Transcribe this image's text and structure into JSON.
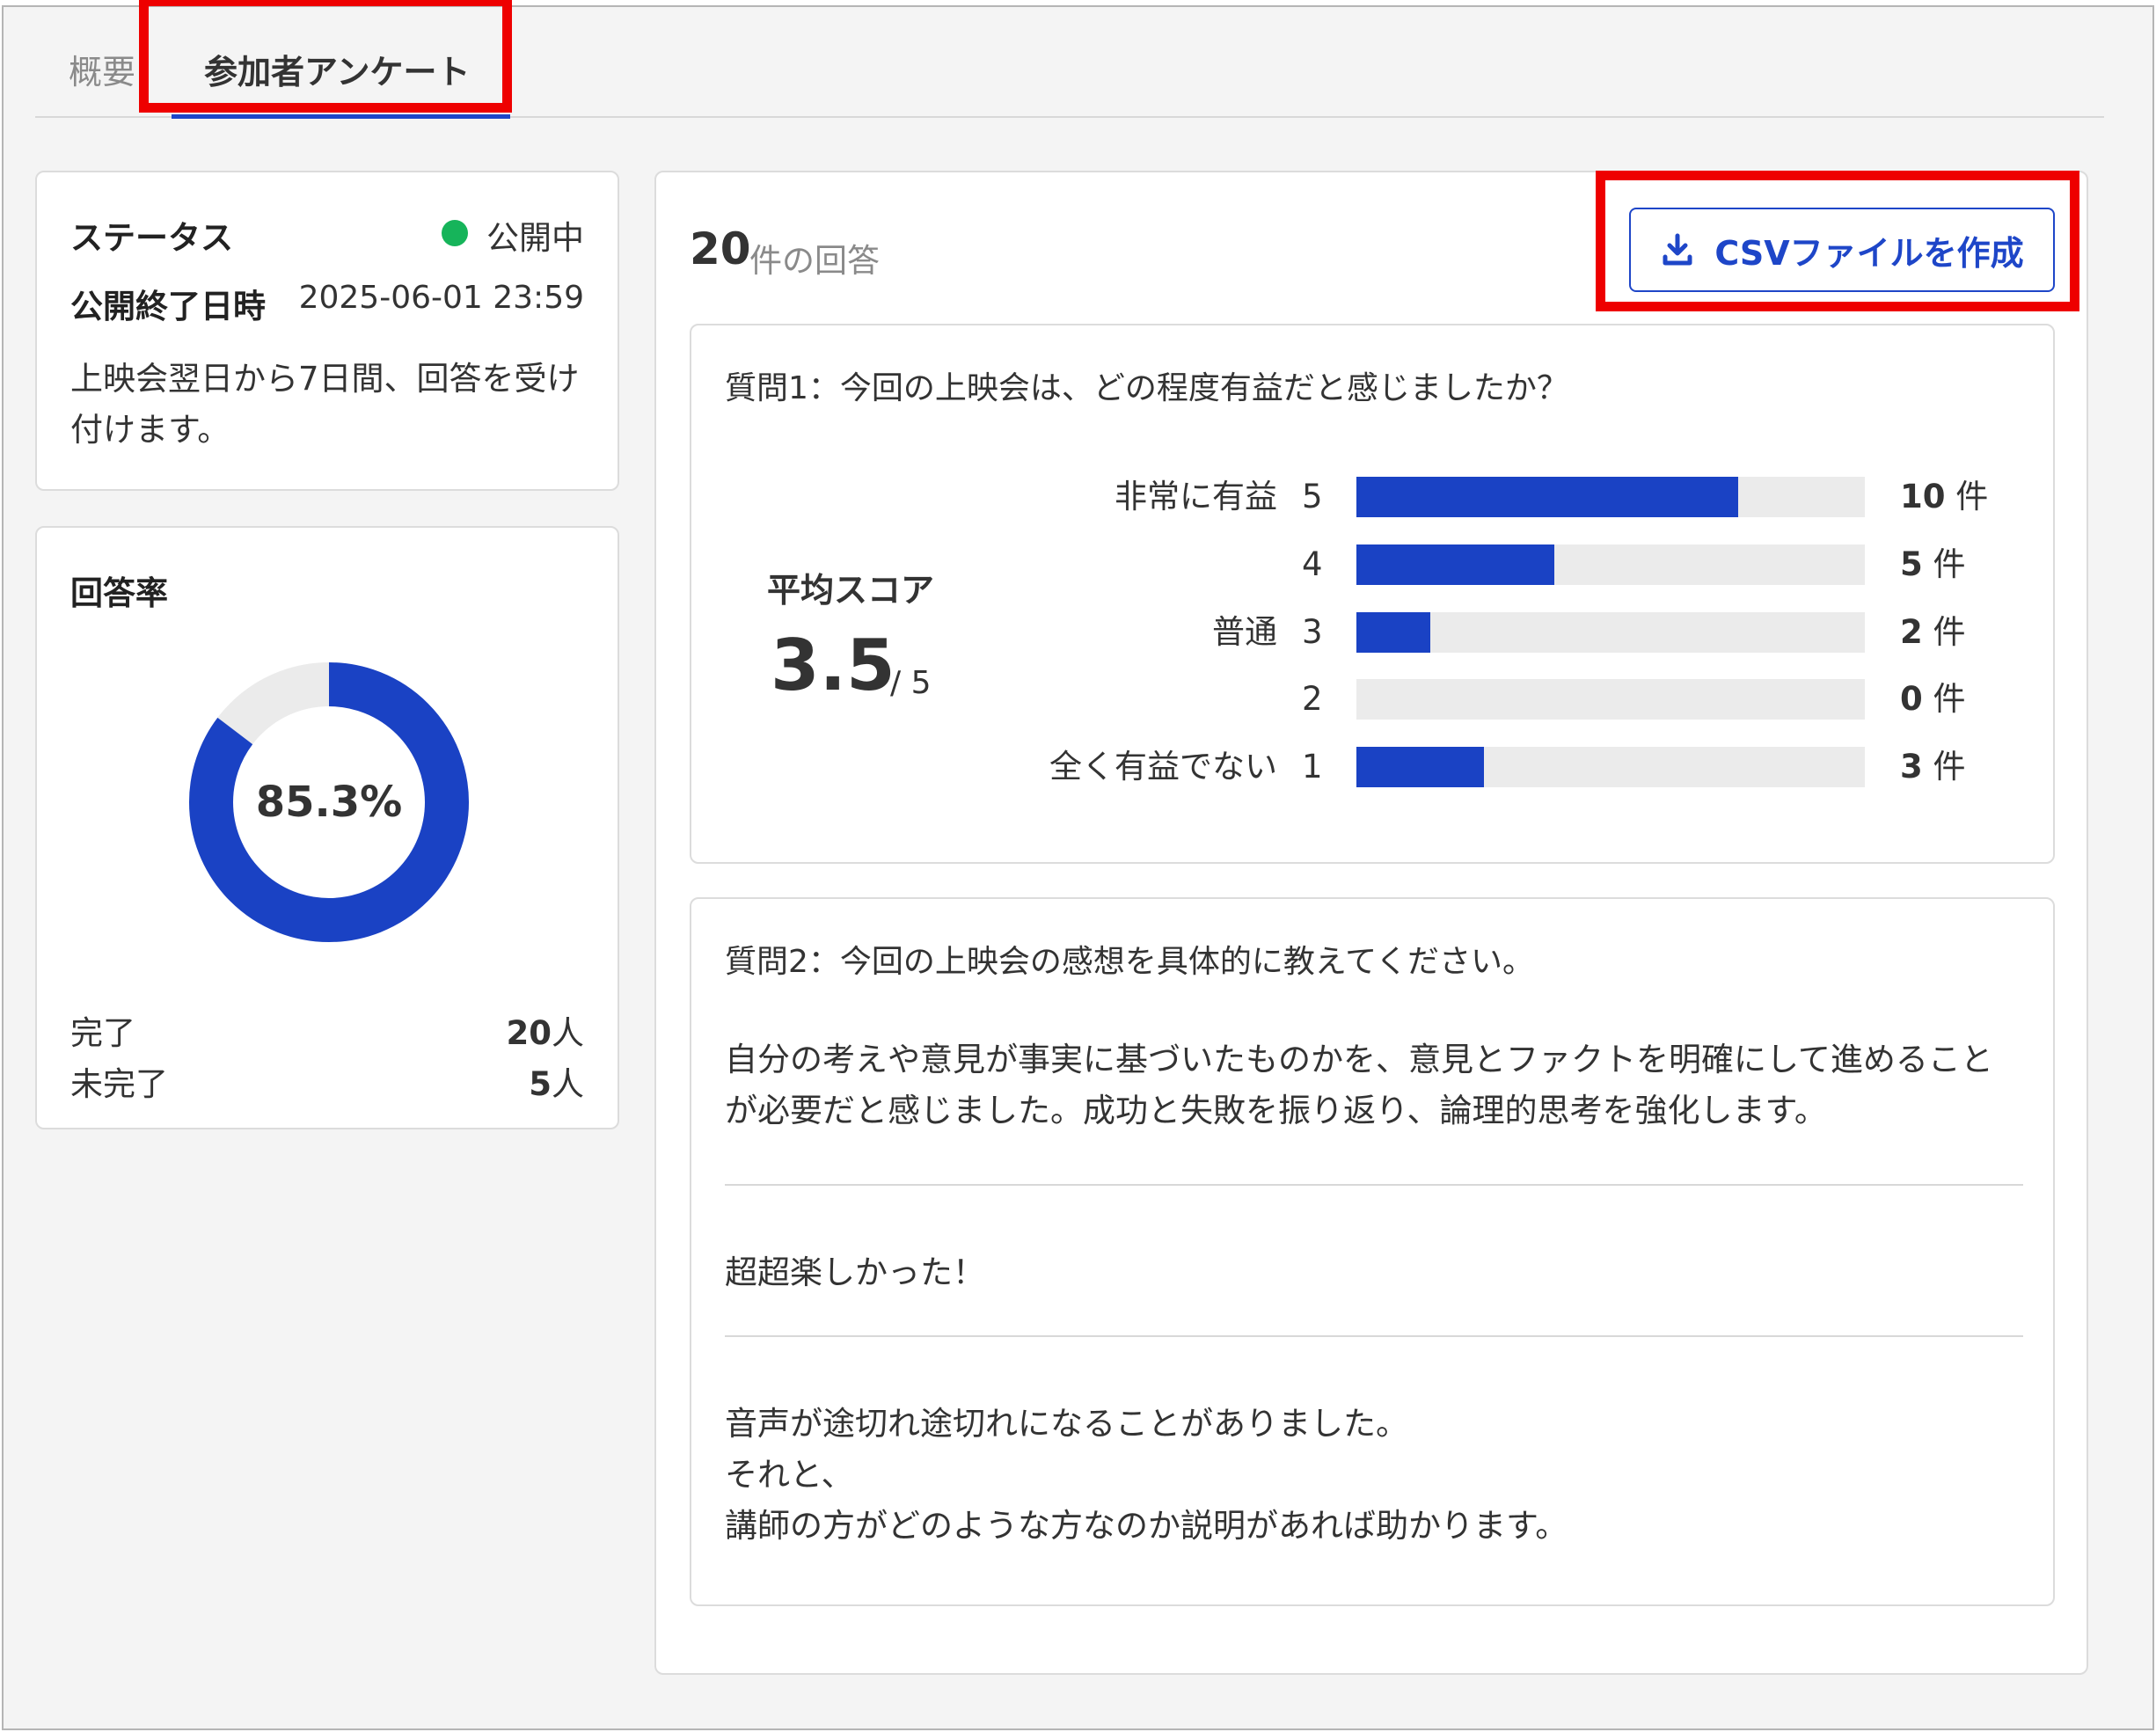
{
  "tabs": [
    {
      "label": "概要",
      "active": false
    },
    {
      "label": "参加者アンケート",
      "active": true
    }
  ],
  "status_card": {
    "title": "ステータス",
    "status": "公開中",
    "status_color": "#16b45a",
    "end_label": "公開終了日時",
    "end_value": "2025-06-01 23:59",
    "description": "上映会翌日から7日間、回答を受け付けます。"
  },
  "rate_card": {
    "title": "回答率",
    "percent_text": "85.3%",
    "percent_value": 85.3,
    "done_label": "完了",
    "done_value": "20",
    "done_unit": "人",
    "pending_label": "未完了",
    "pending_value": "5",
    "pending_unit": "人",
    "fill_color": "#1a42c4",
    "track_color": "#ebebeb"
  },
  "summary": {
    "count": "20",
    "count_label": "件の回答",
    "csv_button": "CSVファイルを作成",
    "csv_icon": "download-icon"
  },
  "question1": {
    "text": "質問1：今回の上映会は、どの程度有益だと感じましたか？",
    "avg_label": "平均スコア",
    "avg_value": "3.5",
    "avg_max": "/ 5",
    "max_count": 10,
    "rows": [
      {
        "label": "非常に有益",
        "score": "5",
        "count": "10",
        "count_value": 10,
        "unit": "件",
        "fill_fraction": 0.75
      },
      {
        "label": "",
        "score": "4",
        "count": "5",
        "count_value": 5,
        "unit": "件",
        "fill_fraction": 0.39
      },
      {
        "label": "普通",
        "score": "3",
        "count": "2",
        "count_value": 2,
        "unit": "件",
        "fill_fraction": 0.145
      },
      {
        "label": "",
        "score": "2",
        "count": "0",
        "count_value": 0,
        "unit": "件",
        "fill_fraction": 0
      },
      {
        "label": "全く有益でない",
        "score": "1",
        "count": "3",
        "count_value": 3,
        "unit": "件",
        "fill_fraction": 0.25
      }
    ]
  },
  "question2": {
    "text": "質問2：今回の上映会の感想を具体的に教えてください。",
    "answers": [
      "自分の考えや意見が事実に基づいたものかを、意見とファクトを明確にして進めることが必要だと感じました。成功と失敗を振り返り、論理的思考を強化します。",
      "超超楽しかった！",
      "音声が途切れ途切れになることがありました。\nそれと、\n講師の方がどのような方なのか説明があれば助かります。"
    ]
  }
}
